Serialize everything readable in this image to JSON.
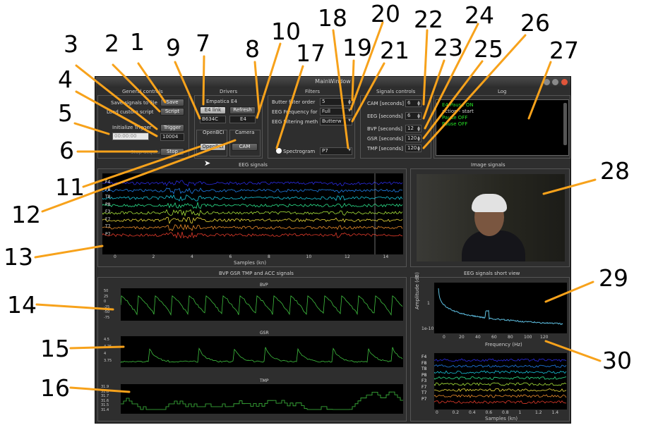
{
  "window": {
    "title": "MainWindow"
  },
  "general": {
    "title": "General controls",
    "save_label": "Save signals to file",
    "save_btn": "Save",
    "script_label": "Load custom script",
    "script_btn": "Script",
    "trigger_label": "Initialize Trigger",
    "trigger_time": "00:00:00",
    "trigger_btn": "Trigger",
    "trigger_value": "10004",
    "stop_label": "Stop acquisition",
    "stop_btn": "Stop"
  },
  "drivers": {
    "title": "Drivers",
    "empatica_label": "Empatica E4",
    "e4link_btn": "E4 link",
    "refresh_btn": "Refresh",
    "device_select": "B634C",
    "e4_field": "E4",
    "openbci_label": "OpenBCI",
    "openbci_btn": "OpenBCI",
    "camera_label": "Camera",
    "cam_btn": "CAM"
  },
  "filters": {
    "title": "Filters",
    "order_label": "Butter filter order",
    "order_value": "5",
    "freq_label": "EEG Frequency for",
    "freq_value": "Full",
    "method_label": "EEG Filtering meth",
    "method_value": "Butterw",
    "spectrogram_label": "Spectrogram",
    "channel_value": "P7"
  },
  "signals_controls": {
    "title": "Signals controls",
    "rows": [
      {
        "label": "CAM [seconds]",
        "value": "6"
      },
      {
        "label": "EEG [seconds]",
        "value": "6"
      },
      {
        "label": "BVP [seconds]",
        "value": "12"
      },
      {
        "label": "GSR [seconds]",
        "value": "120"
      },
      {
        "label": "TMP [seconds]",
        "value": "120"
      }
    ]
  },
  "log": {
    "title": "Log",
    "lines": [
      "E4 Pause ON",
      "action - start",
      "Pause OFF",
      "Pause OFF"
    ]
  },
  "eeg": {
    "title": "EEG signals",
    "channels": [
      "F4",
      "F8",
      "T8",
      "P8",
      "F3",
      "F7",
      "T7",
      "P7"
    ],
    "xlabel": "Samples (kn)",
    "xticks": [
      "0",
      "2",
      "4",
      "6",
      "8",
      "10",
      "12",
      "14"
    ]
  },
  "image": {
    "title": "Image signals"
  },
  "bvp_panel": {
    "title": "BVP GSR TMP and ACC signals",
    "bvp_title": "BVP",
    "gsr_title": "GSR",
    "tmp_title": "TMP",
    "bvp_ticks": [
      "50",
      "25",
      "0",
      "-25",
      "-50",
      "-75"
    ],
    "gsr_ticks": [
      "4.5",
      "4.25",
      "4",
      "3.75"
    ],
    "tmp_ticks": [
      "31.9",
      "31.8",
      "31.7",
      "31.6",
      "31.5",
      "31.4"
    ]
  },
  "short": {
    "title": "EEG signals short view",
    "ylabel": "Amplitude (dB)",
    "xlabel": "Frequency (Hz)",
    "yticks": [
      "1",
      "1e-10"
    ],
    "xticks": [
      "0",
      "20",
      "40",
      "60",
      "80",
      "100",
      "120"
    ],
    "channels": [
      "F4",
      "F8",
      "T8",
      "P8",
      "F3",
      "F7",
      "T7",
      "P7"
    ],
    "xlabel2": "Samples (kn)",
    "xticks2": [
      "0",
      "0.2",
      "0.4",
      "0.6",
      "0.8",
      "1",
      "1.2",
      "1.4"
    ]
  },
  "annotations": [
    "1",
    "2",
    "3",
    "4",
    "5",
    "6",
    "7",
    "8",
    "9",
    "10",
    "11",
    "12",
    "13",
    "14",
    "15",
    "16",
    "17",
    "18",
    "19",
    "20",
    "21",
    "22",
    "23",
    "24",
    "25",
    "26",
    "27",
    "28",
    "29",
    "30"
  ],
  "colors": {
    "annotation_line": "#f7a21b",
    "window_bg": "#2e2e2e",
    "plot_bg": "#000000",
    "log_text": "#26e026",
    "bvp_line": "#3fbf3f"
  }
}
